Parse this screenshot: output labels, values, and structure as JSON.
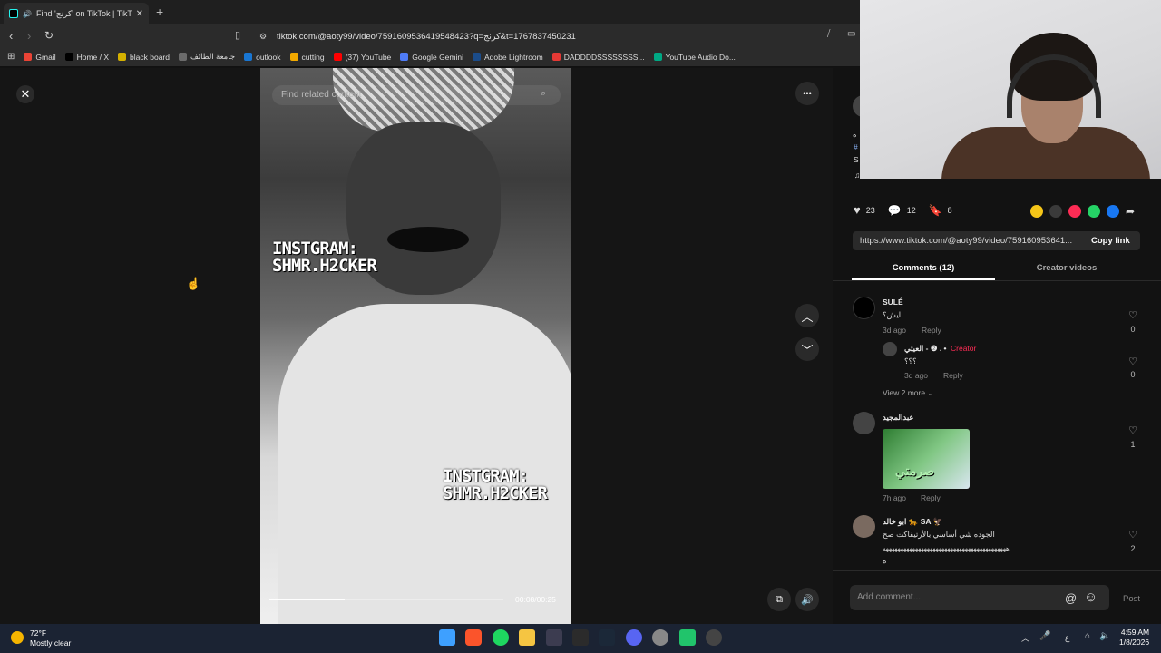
{
  "browser": {
    "tab_title": "Find 'كرنج' on TikTok | TikTok",
    "tab_close": "✕",
    "new_tab": "+",
    "url": "tiktok.com/@aoty99/video/7591609536419548423?q=كرنج&t=1767837450231",
    "bookmarks": [
      "Gmail",
      "Home / X",
      "black board",
      "جامعة الطائف",
      "outlook",
      "cutting",
      "(37) YouTube",
      "Google Gemini",
      "Adobe Lightroom",
      "DADDDDSSSSSSSS...",
      "YouTube Audio Do..."
    ],
    "bookmark_colors": [
      "#ea4335",
      "#000000",
      "#d4b000",
      "#6b6b6b",
      "#1976d2",
      "#f2a900",
      "#ff0000",
      "#4f7cf7",
      "#1b4c8a",
      "#e53935",
      "#00a884"
    ]
  },
  "video": {
    "search_placeholder": "Find related content",
    "watermark_line1": "INSTGRAM:",
    "watermark_line2": "SHMR.H2CKER",
    "watermark2_line1": "INSTGRAM:",
    "watermark2_line2": "SHMR.H2CKER",
    "time": "00:08/00:25",
    "progress": 0.32
  },
  "controls": {
    "close": "✕",
    "more": "•••",
    "up": "︿",
    "down": "﹀",
    "mute": "🔊",
    "caption": "⧉"
  },
  "panel": {
    "desc_line1": "ه",
    "desc_line2": "#",
    "desc_line3": "S",
    "music_note": "♫",
    "likes": "23",
    "comments": "12",
    "saves": "8",
    "share_colors": [
      "#f5c518",
      "#3a3a3a",
      "#fe2c55",
      "#25d366",
      "#1877f2"
    ],
    "link": "https://www.tiktok.com/@aoty99/video/759160953641...",
    "copy_label": "Copy link",
    "tab_comments": "Comments (12)",
    "tab_creator": "Creator videos"
  },
  "comments": [
    {
      "name": "SULÉ",
      "text": "ايش؟",
      "age": "3d ago",
      "reply": "Reply",
      "likes": "0"
    },
    {
      "name": "العيثي - ❷ . •",
      "badge": "Creator",
      "text": "؟؟؟",
      "age": "3d ago",
      "reply": "Reply",
      "likes": "0"
    },
    {
      "name": "عبدالمجيد",
      "text": "",
      "age": "7h ago",
      "reply": "Reply",
      "likes": "1",
      "sticker": "صرمتي"
    },
    {
      "name": "ابو خالد 🐆 SA 🦅",
      "text": "الجوده شي أساسي بالأرتيفاكت صح",
      "text2": "ههههههههههههههههههههههههههههههههههههههههههه",
      "text3": "ه",
      "likes": "2"
    }
  ],
  "view_more": "View 2 more",
  "add_comment": {
    "placeholder": "Add comment...",
    "mention": "@",
    "emoji": "☺",
    "post": "Post"
  },
  "taskbar": {
    "temp": "72°F",
    "weather": "Mostly clear",
    "time": "4:59 AM",
    "date": "1/8/2026",
    "lang": "ع"
  }
}
